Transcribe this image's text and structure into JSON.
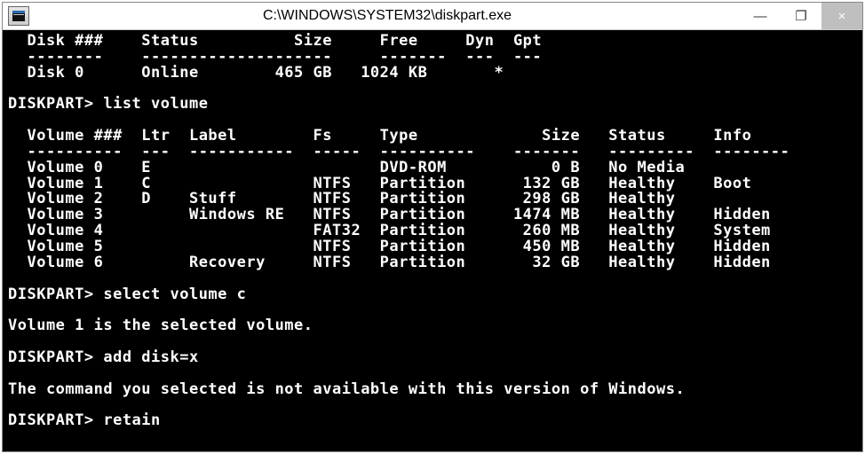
{
  "window": {
    "title": "C:\\WINDOWS\\SYSTEM32\\diskpart.exe",
    "controls": {
      "minimize": "—",
      "maximize": "❐",
      "close": "×"
    }
  },
  "disk_table": {
    "hdr": {
      "num": "Disk ###",
      "status": "Status",
      "size": "Size",
      "free": "Free",
      "dyn": "Dyn",
      "gpt": "Gpt"
    },
    "rows": [
      {
        "num": "Disk 0",
        "status": "Online",
        "size": "465 GB",
        "free": "1024 KB",
        "dyn": "",
        "gpt": "*"
      }
    ]
  },
  "prompts": {
    "p1": "DISKPART>",
    "cmd1": "list volume",
    "p2": "DISKPART>",
    "cmd2": "select volume c",
    "p3": "DISKPART>",
    "cmd3": "add disk=x",
    "p4": "DISKPART>",
    "cmd4": "retain"
  },
  "volume_table": {
    "hdr": {
      "num": "Volume ###",
      "ltr": "Ltr",
      "label": "Label",
      "fs": "Fs",
      "type": "Type",
      "size": "Size",
      "status": "Status",
      "info": "Info"
    },
    "rows": [
      {
        "num": "Volume 0",
        "ltr": "E",
        "label": "",
        "fs": "",
        "type": "DVD-ROM",
        "size": "0 B",
        "status": "No Media",
        "info": ""
      },
      {
        "num": "Volume 1",
        "ltr": "C",
        "label": "",
        "fs": "NTFS",
        "type": "Partition",
        "size": "132 GB",
        "status": "Healthy",
        "info": "Boot"
      },
      {
        "num": "Volume 2",
        "ltr": "D",
        "label": "Stuff",
        "fs": "NTFS",
        "type": "Partition",
        "size": "298 GB",
        "status": "Healthy",
        "info": ""
      },
      {
        "num": "Volume 3",
        "ltr": "",
        "label": "Windows RE",
        "fs": "NTFS",
        "type": "Partition",
        "size": "1474 MB",
        "status": "Healthy",
        "info": "Hidden"
      },
      {
        "num": "Volume 4",
        "ltr": "",
        "label": "",
        "fs": "FAT32",
        "type": "Partition",
        "size": "260 MB",
        "status": "Healthy",
        "info": "System"
      },
      {
        "num": "Volume 5",
        "ltr": "",
        "label": "",
        "fs": "NTFS",
        "type": "Partition",
        "size": "450 MB",
        "status": "Healthy",
        "info": "Hidden"
      },
      {
        "num": "Volume 6",
        "ltr": "",
        "label": "Recovery",
        "fs": "NTFS",
        "type": "Partition",
        "size": "32 GB",
        "status": "Healthy",
        "info": "Hidden"
      }
    ]
  },
  "messages": {
    "selected": "Volume 1 is the selected volume.",
    "not_avail": "The command you selected is not available with this version of Windows."
  }
}
